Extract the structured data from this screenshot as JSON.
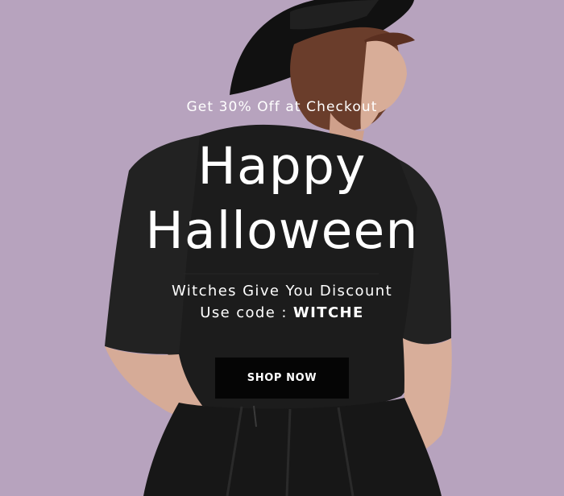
{
  "hero": {
    "offer_text": "Get 30% Off at Checkout",
    "headline_line1": "Happy",
    "headline_line2": "Halloween",
    "subtitle_line1": "Witches Give You Discount",
    "code_prefix": "Use code : ",
    "code_value": "WITCHE",
    "button_label": "SHOP NOW"
  },
  "colors": {
    "background": "#b7a3be",
    "text": "#ffffff",
    "button_bg": "#050505",
    "shirt": "#1c1c1c",
    "skin": "#d9b2a0",
    "hair": "#6a3d2b",
    "hat": "#111111"
  }
}
